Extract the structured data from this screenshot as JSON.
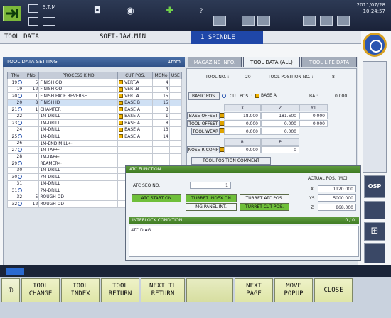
{
  "topbar": {
    "mode_label": "S.T.M",
    "datetime_line1": "2011/07/28",
    "datetime_line2": "10:24:57"
  },
  "titlebar": {
    "screen": "TOOL DATA",
    "program": "SOFT-JAW.MIN",
    "spindle": "1 SPINDLE"
  },
  "left_panel": {
    "title": "TOOL DATA SETTING",
    "unit": "1mm",
    "columns": [
      "TNo",
      "PNo",
      "PROCESS KIND",
      "CUT POS.",
      "MGNo",
      "USE"
    ],
    "rows": [
      {
        "tno": "19",
        "pno": "5",
        "kind": "FINISH OD",
        "pos": "VERT.A",
        "mg": "4",
        "use": ""
      },
      {
        "tno": "19",
        "pno": "12",
        "kind": "FINISH OD",
        "pos": "VERT.B",
        "mg": "4",
        "use": ""
      },
      {
        "tno": "20",
        "pno": "1",
        "kind": "FINISH FACE REVERSE",
        "pos": "VERT.A",
        "mg": "15",
        "use": ""
      },
      {
        "tno": "20",
        "pno": "8",
        "kind": "FINISH ID",
        "pos": "BASE B",
        "mg": "15",
        "use": ""
      },
      {
        "tno": "21",
        "pno": "1",
        "kind": "CHAMFER",
        "pos": "BASE A",
        "mg": "3",
        "use": ""
      },
      {
        "tno": "22",
        "pno": "",
        "kind": "1M-DRILL",
        "pos": "BASE A",
        "mg": "1",
        "use": ""
      },
      {
        "tno": "23",
        "pno": "",
        "kind": "1M-DRILL",
        "pos": "BASE A",
        "mg": "8",
        "use": ""
      },
      {
        "tno": "24",
        "pno": "",
        "kind": "1M-DRILL",
        "pos": "BASE A",
        "mg": "13",
        "use": ""
      },
      {
        "tno": "25",
        "pno": "",
        "kind": "1M-DRILL",
        "pos": "BASE A",
        "mg": "14",
        "use": ""
      },
      {
        "tno": "26",
        "pno": "",
        "kind": "1M-END MILL",
        "pos": "",
        "mg": "",
        "use": ""
      },
      {
        "tno": "27",
        "pno": "",
        "kind": "1M-TAP",
        "pos": "",
        "mg": "",
        "use": ""
      },
      {
        "tno": "28",
        "pno": "",
        "kind": "1M-TAP",
        "pos": "",
        "mg": "",
        "use": ""
      },
      {
        "tno": "29",
        "pno": "",
        "kind": "REAMER",
        "pos": "",
        "mg": "",
        "use": ""
      },
      {
        "tno": "30",
        "pno": "",
        "kind": "1M-DRILL",
        "pos": "",
        "mg": "",
        "use": ""
      },
      {
        "tno": "30",
        "pno": "",
        "kind": "7M-DRILL",
        "pos": "",
        "mg": "",
        "use": ""
      },
      {
        "tno": "31",
        "pno": "",
        "kind": "1M-DRILL",
        "pos": "",
        "mg": "",
        "use": ""
      },
      {
        "tno": "31",
        "pno": "",
        "kind": "7M-DRILL",
        "pos": "",
        "mg": "",
        "use": ""
      },
      {
        "tno": "32",
        "pno": "5",
        "kind": "ROUGH OD",
        "pos": "",
        "mg": "",
        "use": ""
      },
      {
        "tno": "32",
        "pno": "12",
        "kind": "ROUGH OD",
        "pos": "",
        "mg": "",
        "use": ""
      }
    ]
  },
  "tabs": [
    "MAGAZINE INFO.",
    "TOOL DATA (ALL)",
    "TOOL LIFE DATA"
  ],
  "right_panel": {
    "tool_no_label": "TOOL NO. :",
    "tool_no": "20",
    "tool_pos_label": "TOOL POSITION NO. :",
    "tool_pos": "8",
    "basic_pos": "BASIC POS.",
    "cut_pos_label": "CUT POS. :",
    "cut_pos": "BASE A",
    "ba_label": "BA :",
    "ba_value": "0.000",
    "col_x": "X",
    "col_z": "Z",
    "col_y1": "Y1",
    "base_offset": "BASE OFFSET",
    "base_offset_vals": [
      "-18.000",
      "181.600",
      "0.000"
    ],
    "tool_offset": "TOOL OFFSET",
    "tool_offset_vals": [
      "0.000",
      "0.000",
      "0.000"
    ],
    "tool_wear": "TOOL WEAR",
    "tool_wear_vals": [
      "0.000",
      "0.000"
    ],
    "col_r": "R",
    "col_p": "P",
    "nose_r": "NOSE-R COMP",
    "nose_r_vals": [
      "0.000",
      "0"
    ],
    "tool_comment": "TOOL POSITION COMMENT"
  },
  "atc_popup": {
    "title": "ATC FUNCTION",
    "seq_label": "ATC SEQ NO.",
    "seq_value": "1",
    "actual_label": "ACTUAL POS. (MC)",
    "axes": [
      {
        "name": "X",
        "value": "1120.000"
      },
      {
        "name": "YS",
        "value": "5000.000"
      },
      {
        "name": "Z",
        "value": "868.000"
      }
    ],
    "btn_atc_start": "ATC START ON",
    "btn_turret_index": "TURRET INDEX ON",
    "btn_turret_atc": "TURRET ATC POS.",
    "btn_mg_panel": "MG PANEL INT.",
    "btn_turret_cut": "TURRET CUT POS.",
    "interlock_title": "INTERLOCK CONDITION",
    "interlock_count": "0 / 0",
    "diag_text": "ATC DIAG."
  },
  "function_keys": [
    "TOOL\nCHANGE",
    "TOOL\nINDEX",
    "TOOL\nRETURN",
    "NEXT TL\nRETURN",
    "",
    "NEXT\nPAGE",
    "MOVE\nPOPUP",
    "CLOSE"
  ],
  "colors": {
    "accent": "#1f47a8",
    "active_green": "#6fbf3a",
    "header_blue": "#2e4f85"
  }
}
